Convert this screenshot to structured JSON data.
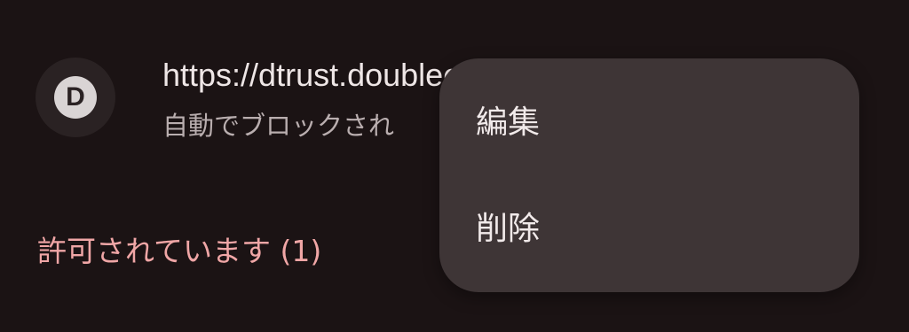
{
  "site": {
    "avatar_letter": "D",
    "url": "https://dtrust.doublecl",
    "status": "自動でブロックされ"
  },
  "section": {
    "allowed_header": "許可されています (1)"
  },
  "menu": {
    "items": [
      {
        "label": "編集"
      },
      {
        "label": "削除"
      }
    ]
  },
  "colors": {
    "background": "#1b1314",
    "menu_surface": "#3e3536",
    "accent_header": "#f0a6a6",
    "primary_text": "#eee6e6",
    "secondary_text": "#b9aeaf"
  }
}
